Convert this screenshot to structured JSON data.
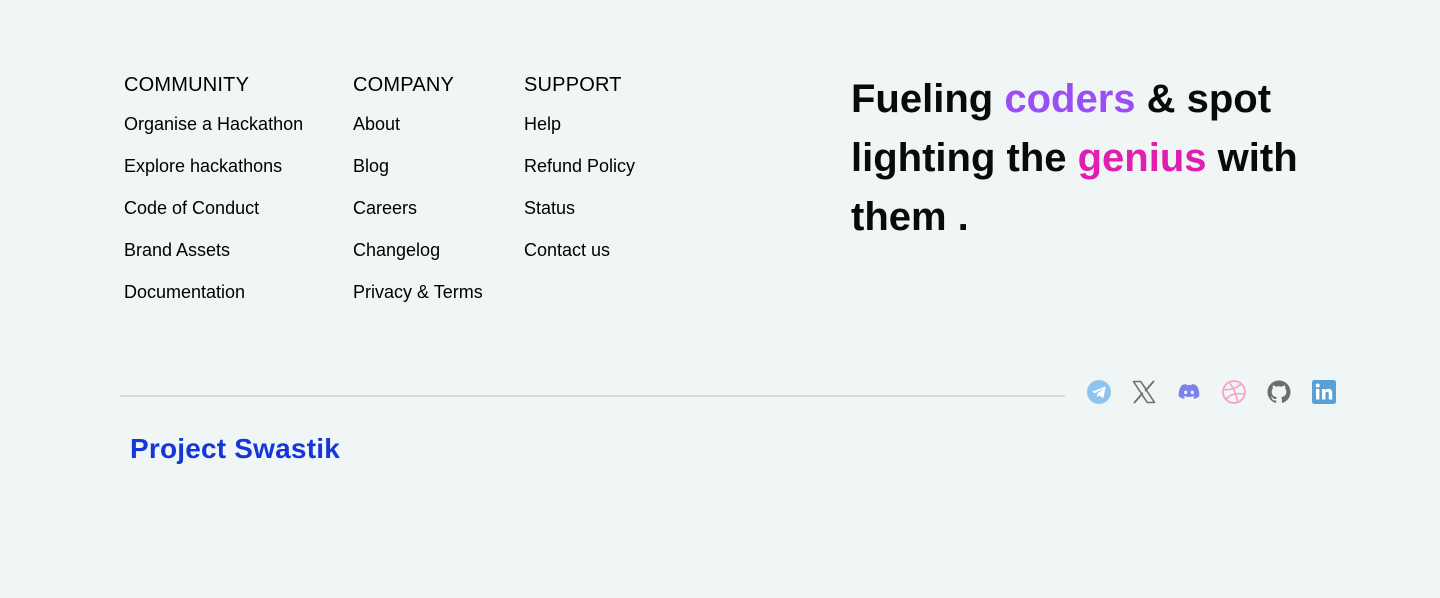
{
  "footer": {
    "columns": [
      {
        "heading": "COMMUNITY",
        "links": [
          "Organise a Hackathon",
          "Explore hackathons",
          "Code of Conduct",
          "Brand Assets",
          "Documentation"
        ]
      },
      {
        "heading": "COMPANY",
        "links": [
          "About",
          "Blog",
          "Careers",
          "Changelog",
          "Privacy & Terms"
        ]
      },
      {
        "heading": "SUPPORT",
        "links": [
          "Help",
          "Refund Policy",
          "Status",
          "Contact us"
        ]
      }
    ],
    "tagline": {
      "part1": "Fueling ",
      "highlight1": "coders",
      "part2": " & spot lighting the ",
      "highlight2": "genius",
      "part3": " with them .",
      "highlight1_color": "#9b4ef5",
      "highlight2_color": "#e01fb0"
    },
    "socials": [
      {
        "icon": "telegram-icon",
        "color": "#8ec5ee"
      },
      {
        "icon": "x-icon",
        "color": "#6f6f6f"
      },
      {
        "icon": "discord-icon",
        "color": "#7b83eb"
      },
      {
        "icon": "dribbble-icon",
        "color": "#f3a3c3"
      },
      {
        "icon": "github-icon",
        "color": "#6e6e6e"
      },
      {
        "icon": "linkedin-icon",
        "color": "#5aa0d8"
      }
    ],
    "brand": "Project Swastik",
    "brand_color": "#1536d8"
  }
}
